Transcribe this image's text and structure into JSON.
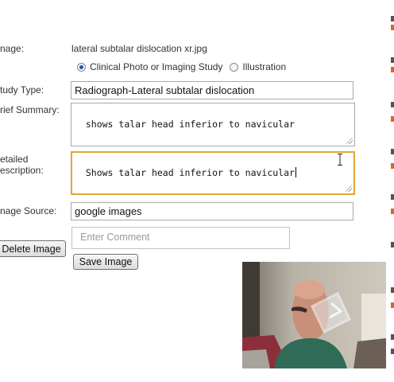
{
  "form": {
    "image_label": "nage:",
    "image_filename": "lateral subtalar dislocation xr.jpg",
    "image_type_options": [
      {
        "label": "Clinical Photo or Imaging Study",
        "selected": true
      },
      {
        "label": "Illustration",
        "selected": false
      }
    ],
    "study_type_label": "tudy Type:",
    "study_type_value": "Radiograph-Lateral subtalar dislocation",
    "brief_summary_label": "rief Summary:",
    "brief_summary_value": "shows talar head inferior to navicular",
    "detailed_label_line1": "etailed",
    "detailed_label_line2": "escription:",
    "detailed_value": "Shows talar head inferior to navicular",
    "image_source_label": "nage Source:",
    "image_source_value": "google images",
    "delete_button": "Delete Image",
    "comment_placeholder": "Enter Comment",
    "save_button": "Save Image"
  },
  "colors": {
    "focus_border": "#e3a533",
    "radio_selected": "#1a55b8",
    "sidebar_accent_dark": "#555555",
    "sidebar_accent_orange": "#d06a2a"
  },
  "icons": {
    "ibeam": "text-cursor-icon",
    "resize": "resize-grip-icon"
  },
  "video": {
    "description": "webcam overlay"
  }
}
